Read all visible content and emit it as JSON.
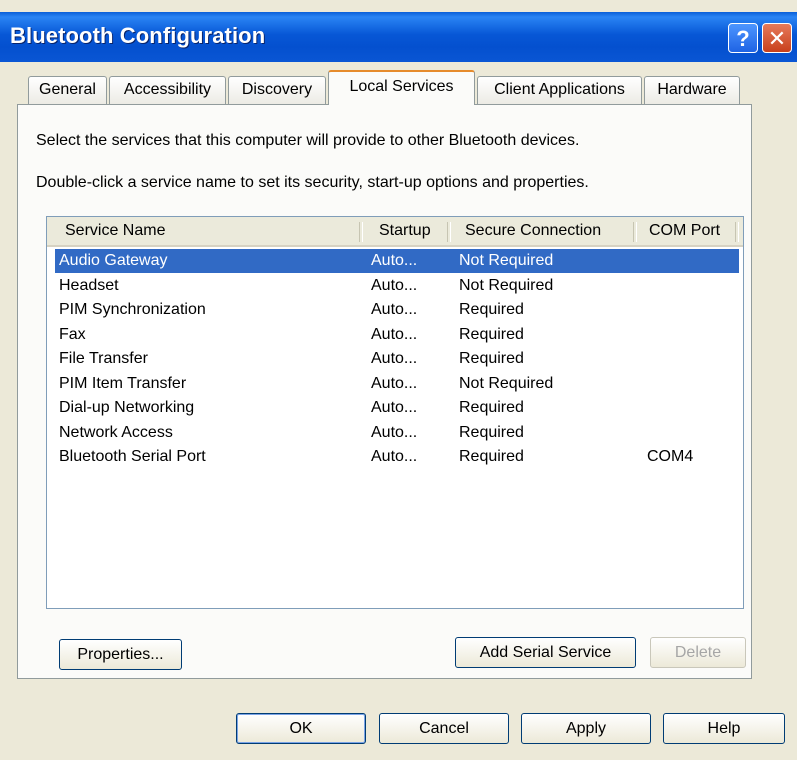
{
  "window": {
    "title": "Bluetooth Configuration",
    "help_label": "?",
    "close_label": "✕"
  },
  "tabs": [
    {
      "label": "General"
    },
    {
      "label": "Accessibility"
    },
    {
      "label": "Discovery"
    },
    {
      "label": "Local Services",
      "active": true
    },
    {
      "label": "Client Applications"
    },
    {
      "label": "Hardware"
    }
  ],
  "panel": {
    "line1": "Select the services that this computer will provide to other Bluetooth devices.",
    "line2": "Double-click a service name to set its security, start-up options and properties."
  },
  "services": {
    "columns": [
      "Service Name",
      "Startup",
      "Secure Connection",
      "COM Port"
    ],
    "rows": [
      {
        "name": "Audio Gateway",
        "startup": "Auto...",
        "secure": "Not Required",
        "com": "",
        "selected": true
      },
      {
        "name": "Headset",
        "startup": "Auto...",
        "secure": "Not Required",
        "com": ""
      },
      {
        "name": "PIM Synchronization",
        "startup": "Auto...",
        "secure": "Required",
        "com": ""
      },
      {
        "name": "Fax",
        "startup": "Auto...",
        "secure": "Required",
        "com": ""
      },
      {
        "name": "File Transfer",
        "startup": "Auto...",
        "secure": "Required",
        "com": ""
      },
      {
        "name": "PIM Item Transfer",
        "startup": "Auto...",
        "secure": "Not Required",
        "com": ""
      },
      {
        "name": "Dial-up Networking",
        "startup": "Auto...",
        "secure": "Required",
        "com": ""
      },
      {
        "name": "Network Access",
        "startup": "Auto...",
        "secure": "Required",
        "com": ""
      },
      {
        "name": "Bluetooth Serial Port",
        "startup": "Auto...",
        "secure": "Required",
        "com": "COM4"
      }
    ]
  },
  "buttons": {
    "properties": "Properties...",
    "add_serial": "Add Serial Service",
    "delete": "Delete",
    "ok": "OK",
    "cancel": "Cancel",
    "apply": "Apply",
    "help": "Help"
  },
  "colors": {
    "selection": "#316ac5",
    "titlebar": "#0757d6",
    "tab_accent": "#e68b2c"
  }
}
